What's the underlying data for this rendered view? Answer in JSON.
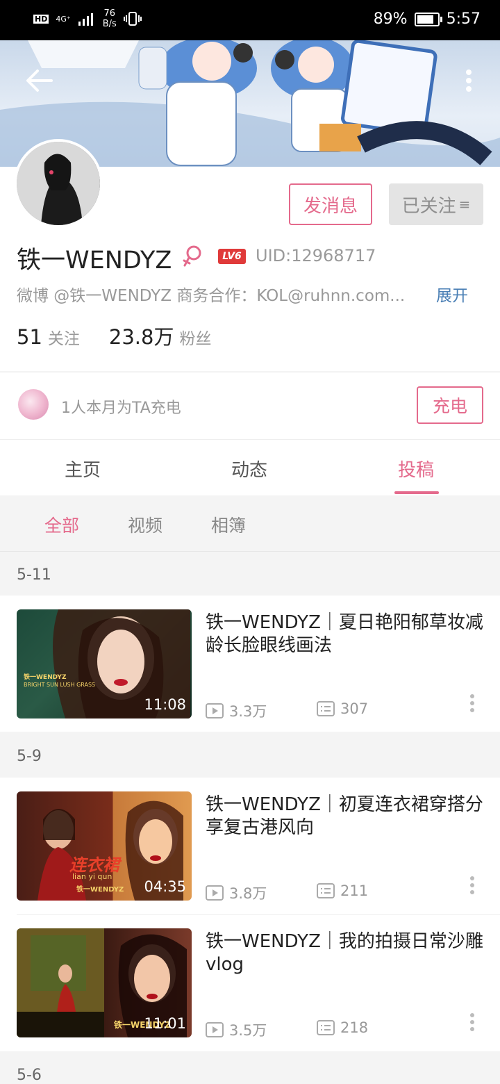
{
  "status_bar": {
    "network": "HD",
    "signal": "4G⁺",
    "speed_value": "76",
    "speed_unit": "B/s",
    "battery": "89%",
    "battery_level": 0.89,
    "time": "5:57"
  },
  "profile": {
    "name": "铁一WENDYZ",
    "level_badge": "LV6",
    "uid": "UID:12968717",
    "bio": "微博 @铁一WENDYZ  商务合作：KOL@ruhnn.com...",
    "expand_label": "展开",
    "following_count": "51",
    "following_label": "关注",
    "fans_count": "23.8万",
    "fans_label": "粉丝",
    "message_button": "发消息",
    "followed_button": "已关注"
  },
  "charge": {
    "text": "1人本月为TA充电",
    "button": "充电"
  },
  "tabs": [
    "主页",
    "动态",
    "投稿"
  ],
  "active_tab": "投稿",
  "sub_tabs": [
    "全部",
    "视频",
    "相簿"
  ],
  "active_sub_tab": "全部",
  "groups": [
    {
      "date": "5-11",
      "videos": [
        {
          "title": "铁一WENDYZ｜夏日艳阳郁草妆减龄长脸眼线画法",
          "duration": "11:08",
          "views": "3.3万",
          "comments": "307"
        }
      ]
    },
    {
      "date": "5-9",
      "videos": [
        {
          "title": "铁一WENDYZ｜初夏连衣裙穿搭分享复古港风向",
          "duration": "04:35",
          "views": "3.8万",
          "comments": "211"
        },
        {
          "title": "铁一WENDYZ｜我的拍摄日常沙雕vlog",
          "duration": "11:01",
          "views": "3.5万",
          "comments": "218"
        }
      ]
    },
    {
      "date": "5-6"
    }
  ],
  "thumb_text": {
    "v1_brand": "铁一WENDYZ",
    "v1_line1": "BRIGHT SUN",
    "v1_line2": "LUSH GRASS",
    "v2_title": "连衣裙",
    "v2_pinyin": "lian   yi   qun",
    "v2_brand": "铁一WENDYZ",
    "v3_brand": "铁一WENDYZ"
  },
  "colors": {
    "accent": "#e46a8c",
    "link": "#4a7fb5",
    "level_badge": "#e03a3a"
  }
}
